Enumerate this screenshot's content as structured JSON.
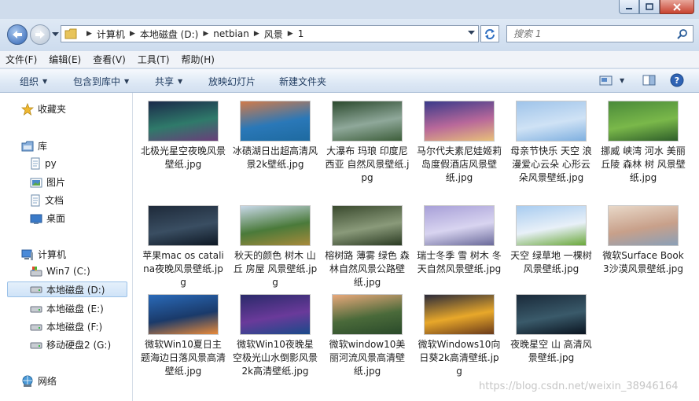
{
  "breadcrumb": [
    "计算机",
    "本地磁盘 (D:)",
    "netbian",
    "风景",
    "1"
  ],
  "search": {
    "placeholder": "搜索 1"
  },
  "menu": [
    "文件(F)",
    "编辑(E)",
    "查看(V)",
    "工具(T)",
    "帮助(H)"
  ],
  "toolbar": {
    "organize": "组织",
    "include": "包含到库中",
    "share": "共享",
    "slideshow": "放映幻灯片",
    "newfolder": "新建文件夹"
  },
  "navpane": {
    "favorites": "收藏夹",
    "libraries": "库",
    "lib_items": [
      "py",
      "图片",
      "文档",
      "桌面"
    ],
    "computer": "计算机",
    "drives": [
      "Win7 (C:)",
      "本地磁盘 (D:)",
      "本地磁盘 (E:)",
      "本地磁盘 (F:)",
      "移动硬盘2 (G:)"
    ],
    "network": "网络"
  },
  "files": [
    {
      "name": "北极光星空夜晚风景壁纸.jpg",
      "colors": [
        "#1b2a4a",
        "#2f7a6a",
        "#6a3e7a"
      ]
    },
    {
      "name": "冰碛湖日出超高清风景2k壁纸.jpg",
      "colors": [
        "#d07a4a",
        "#2a78b8",
        "#1e6aa0"
      ]
    },
    {
      "name": "大瀑布 玛琅 印度尼西亚 自然风景壁纸.jpg",
      "colors": [
        "#2c4a2e",
        "#8fa89a",
        "#3d5e3a"
      ]
    },
    {
      "name": "马尔代夫素尼娃姬莉岛度假酒店风景壁纸.jpg",
      "colors": [
        "#3a3a8a",
        "#b8689a",
        "#e8c07a"
      ]
    },
    {
      "name": "母亲节快乐 天空 浪漫爱心云朵 心形云朵风景壁纸.jpg",
      "colors": [
        "#9fc4ea",
        "#cfe2f5",
        "#7fb0e0"
      ]
    },
    {
      "name": "挪威 峡湾 河水 美丽 丘陵 森林 树 风景壁纸.jpg",
      "colors": [
        "#4a8a3a",
        "#7ab84a",
        "#2e5e2a"
      ]
    },
    {
      "name": "苹果mac os catalina夜晚风景壁纸.jpg",
      "colors": [
        "#1e2a3a",
        "#3a4e62",
        "#0e1824"
      ]
    },
    {
      "name": "秋天的颜色 树木 山丘 房屋 风景壁纸.jpg",
      "colors": [
        "#c8d8e8",
        "#4a7a3a",
        "#a88a3a"
      ]
    },
    {
      "name": "榕树路 薄雾 绿色 森林自然风景公路壁纸.jpg",
      "colors": [
        "#3a4a2e",
        "#8a9a7a",
        "#2a3a22"
      ]
    },
    {
      "name": "瑞士冬季 雪 树木 冬天自然风景壁纸.jpg",
      "colors": [
        "#a8a0d8",
        "#d8d4f0",
        "#6a6a9a"
      ]
    },
    {
      "name": "天空 绿草地 一棵树风景壁纸.jpg",
      "colors": [
        "#a8ccf0",
        "#e8f0f8",
        "#6aa83a"
      ]
    },
    {
      "name": "微软Surface Book 3沙漠风景壁纸.jpg",
      "colors": [
        "#e8d8c8",
        "#c8a08a",
        "#8aa0b8"
      ]
    },
    {
      "name": "微软Win10夏日主题海边日落风景高清壁纸.jpg",
      "colors": [
        "#2a6ab8",
        "#1a3a6a",
        "#e88a3a"
      ]
    },
    {
      "name": "微软Win10夜晚星空极光山水倒影风景2k高清壁纸.jpg",
      "colors": [
        "#2a2a6a",
        "#6a3a9a",
        "#1a4a8a"
      ]
    },
    {
      "name": "微软window10美丽河流风景高清壁纸.jpg",
      "colors": [
        "#e8a87a",
        "#4a6a3a",
        "#2a4a2a"
      ]
    },
    {
      "name": "微软Windows10向日葵2k高清壁纸.jpg",
      "colors": [
        "#2a2a3a",
        "#e8a82a",
        "#6a3a1a"
      ]
    },
    {
      "name": "夜晚星空 山 高清风景壁纸.jpg",
      "colors": [
        "#1a2a3a",
        "#3a5a6a",
        "#0a1420"
      ]
    }
  ],
  "watermark": "https://blog.csdn.net/weixin_38946164"
}
